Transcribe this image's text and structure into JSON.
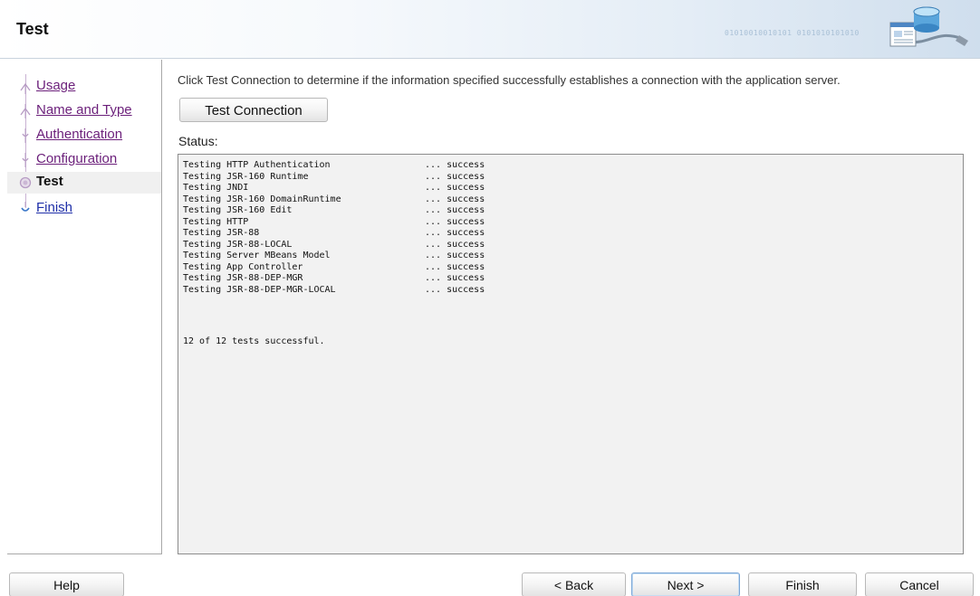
{
  "window": {
    "title": "Test",
    "header_binary": "01010010010101 0101010101010"
  },
  "nav": {
    "items": [
      {
        "label": "Usage",
        "state": "visited"
      },
      {
        "label": "Name and Type",
        "state": "visited"
      },
      {
        "label": "Authentication",
        "state": "visited"
      },
      {
        "label": "Configuration",
        "state": "visited"
      },
      {
        "label": "Test",
        "state": "current"
      },
      {
        "label": "Finish",
        "state": "link"
      }
    ]
  },
  "main": {
    "instructions": "Click Test Connection to determine if the information specified successfully establishes a connection with the application server.",
    "test_button_label": "Test Connection",
    "status_label": "Status:",
    "status_lines": [
      {
        "name": "Testing HTTP Authentication",
        "result": "... success"
      },
      {
        "name": "Testing JSR-160 Runtime",
        "result": "... success"
      },
      {
        "name": "Testing JNDI",
        "result": "... success"
      },
      {
        "name": "Testing JSR-160 DomainRuntime",
        "result": "... success"
      },
      {
        "name": "Testing JSR-160 Edit",
        "result": "... success"
      },
      {
        "name": "Testing HTTP",
        "result": "... success"
      },
      {
        "name": "Testing JSR-88",
        "result": "... success"
      },
      {
        "name": "Testing JSR-88-LOCAL",
        "result": "... success"
      },
      {
        "name": "Testing Server MBeans Model",
        "result": "... success"
      },
      {
        "name": "Testing App Controller",
        "result": "... success"
      },
      {
        "name": "Testing JSR-88-DEP-MGR",
        "result": "... success"
      },
      {
        "name": "Testing JSR-88-DEP-MGR-LOCAL",
        "result": "... success"
      }
    ],
    "summary": "12 of 12 tests successful."
  },
  "footer": {
    "help_label": "Help",
    "back_label": "< Back",
    "next_label": "Next >",
    "finish_label": "Finish",
    "cancel_label": "Cancel"
  },
  "colors": {
    "visited_link": "#6b1f7a",
    "link": "#1f2fa8",
    "selected_row": "#f0f0f0",
    "status_background": "#f2f2f2",
    "header_gradient_end": "#cfdeed"
  },
  "icons": {
    "header": "server-database-connection-icon",
    "nav_completed": "checkpoint-pin-icon",
    "nav_current": "current-step-circle-icon",
    "nav_pending": "pending-step-pin-icon"
  }
}
